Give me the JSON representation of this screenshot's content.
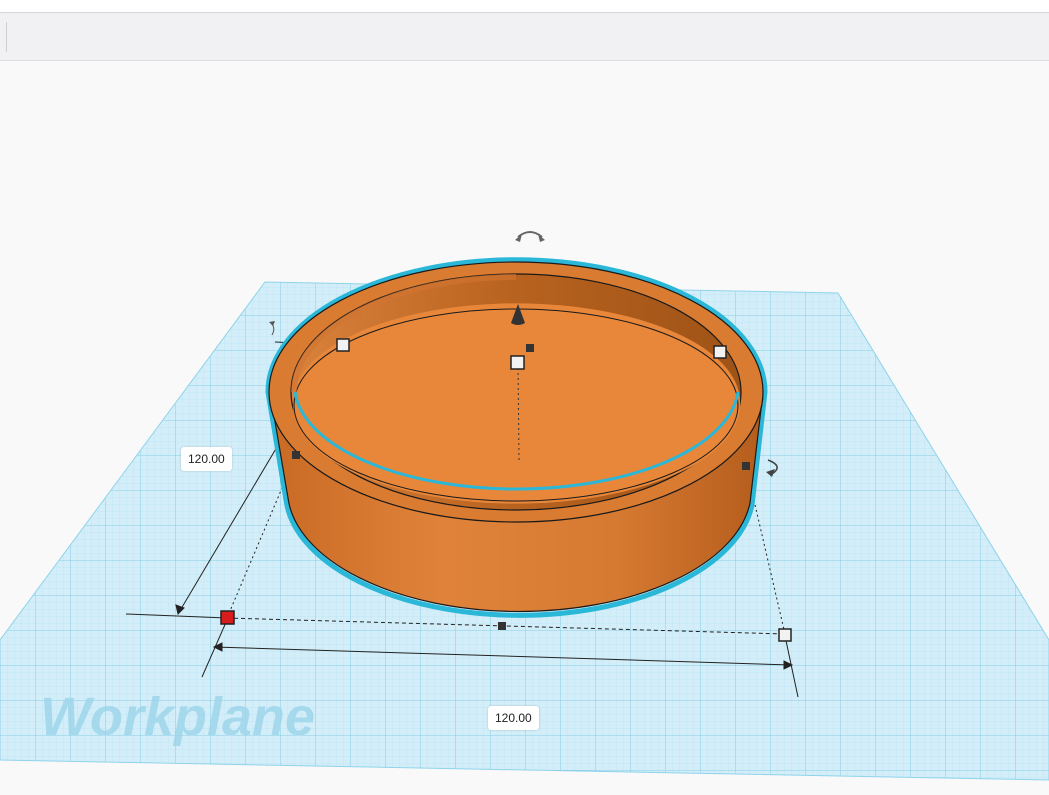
{
  "workplane": {
    "label": "Workplane",
    "grid_color": "#cbe9f5",
    "line_color": "#8fd3ea"
  },
  "shape": {
    "color": "#e8873a",
    "outline_color": "#2bb7d8"
  },
  "dimensions": {
    "width_label": "120.00",
    "length_label": "120.00"
  },
  "icons": {
    "rotate_top": "curved-double-arrow-icon",
    "rotate_side": "curved-arrow-icon",
    "lift": "cone-icon"
  }
}
